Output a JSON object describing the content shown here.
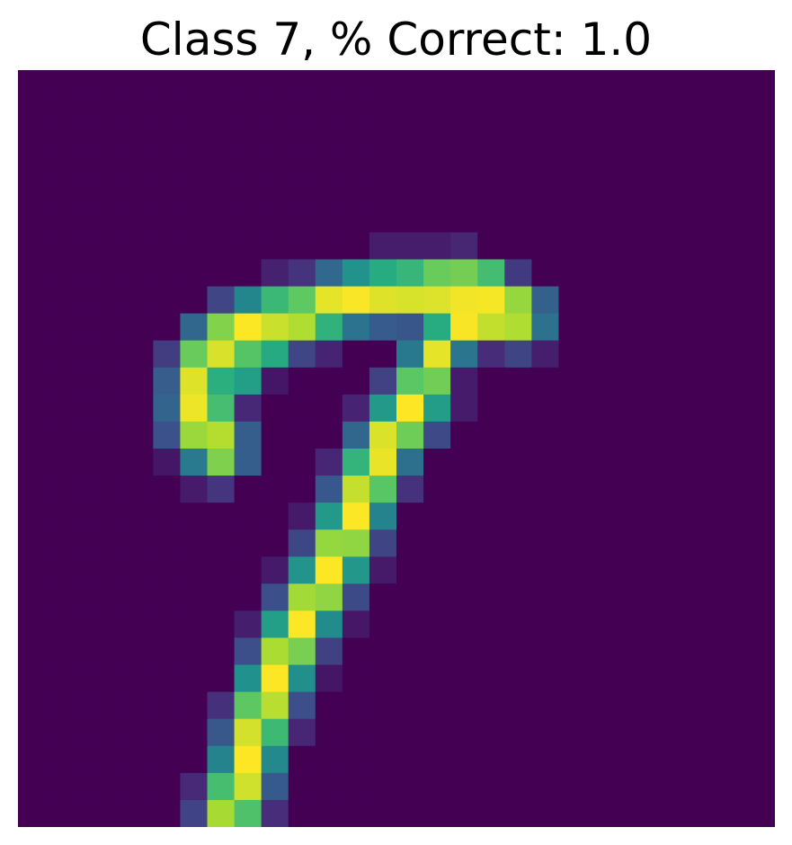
{
  "chart_data": {
    "type": "heatmap",
    "title": "Class 7, % Correct: 1.0",
    "rows": 28,
    "cols": 28,
    "colormap": "viridis",
    "value_range": [
      0,
      1
    ],
    "axes_visible": false,
    "background": "#ffffff",
    "strokes": [
      {
        "points": [
          [
            9.5,
            17.5
          ],
          [
            8.6,
            16.3
          ],
          [
            8.5,
            15.0
          ],
          [
            8.8,
            13.7
          ],
          [
            9.6,
            12.6
          ],
          [
            10.7,
            12.0
          ],
          [
            12.0,
            11.5
          ],
          [
            13.5,
            11.4
          ],
          [
            15.5,
            10.6
          ],
          [
            17.5,
            10.3
          ],
          [
            19.5,
            10.3
          ],
          [
            21.0,
            10.4
          ],
          [
            22.5,
            10.8
          ],
          [
            23.7,
            11.4
          ]
        ],
        "width": 1.1,
        "peak": 1.0
      },
      {
        "points": [
          [
            23.4,
            10.8
          ],
          [
            22.3,
            9.7
          ],
          [
            20.8,
            9.4
          ],
          [
            19.0,
            9.7
          ],
          [
            17.5,
            10.0
          ],
          [
            16.0,
            10.4
          ],
          [
            14.2,
            11.0
          ],
          [
            12.6,
            12.3
          ],
          [
            11.3,
            13.1
          ],
          [
            10.3,
            14.2
          ],
          [
            9.5,
            15.3
          ]
        ],
        "width": 0.75,
        "peak": 0.8
      },
      {
        "points": [
          [
            23.5,
            11.0
          ],
          [
            22.6,
            11.5
          ],
          [
            21.5,
            11.8
          ],
          [
            20.5,
            12.3
          ],
          [
            19.7,
            13.0
          ],
          [
            19.4,
            14.0
          ],
          [
            19.2,
            15.0
          ]
        ],
        "width": 0.85,
        "peak": 1.0
      },
      {
        "points": [
          [
            19.0,
            15.0
          ],
          [
            18.4,
            16.0
          ],
          [
            17.6,
            17.0
          ],
          [
            16.8,
            18.6
          ],
          [
            16.0,
            20.5
          ],
          [
            15.0,
            22.7
          ],
          [
            14.0,
            24.5
          ],
          [
            12.9,
            26.5
          ],
          [
            12.0,
            28.5
          ],
          [
            11.3,
            30.5
          ],
          [
            10.8,
            32.3
          ],
          [
            10.3,
            33.7
          ],
          [
            10.1,
            34.2
          ]
        ],
        "width": 1.1,
        "peak": 1.0
      },
      {
        "points": [
          [
            19.2,
            15.2
          ],
          [
            17.9,
            16.8
          ],
          [
            17.0,
            18.5
          ],
          [
            16.2,
            20.3
          ],
          [
            15.2,
            22.4
          ],
          [
            14.2,
            24.4
          ],
          [
            13.1,
            26.5
          ]
        ],
        "width": 0.6,
        "peak": 0.9
      }
    ],
    "stroke_scale": {
      "x": 0.78,
      "y": 0.8
    }
  }
}
